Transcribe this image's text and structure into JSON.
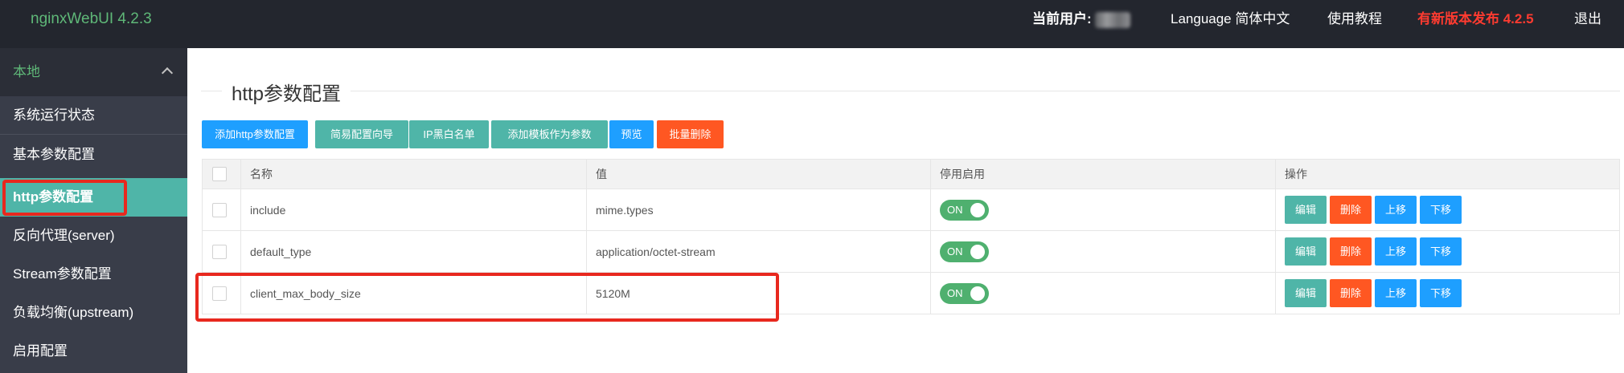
{
  "header": {
    "logo": "nginxWebUI 4.2.3",
    "current_user_label": "当前用户:",
    "language_label": "Language 简体中文",
    "help_label": "使用教程",
    "new_version_label": "有新版本发布 4.2.5",
    "logout_label": "退出"
  },
  "sidebar": {
    "group_label": "本地",
    "items": [
      {
        "label": "系统运行状态"
      },
      {
        "label": "基本参数配置"
      },
      {
        "label": "http参数配置"
      },
      {
        "label": "反向代理(server)"
      },
      {
        "label": "Stream参数配置"
      },
      {
        "label": "负载均衡(upstream)"
      },
      {
        "label": "启用配置"
      }
    ]
  },
  "main": {
    "title": "http参数配置",
    "toolbar": {
      "add_http": "添加http参数配置",
      "wizard": "简易配置向导",
      "ip_blacklist": "IP黑白名单",
      "add_template": "添加模板作为参数",
      "preview": "预览",
      "batch_delete": "批量删除"
    }
  },
  "table": {
    "headers": [
      "名称",
      "值",
      "停用启用",
      "操作"
    ],
    "rows": [
      {
        "name": "include",
        "value": "mime.types",
        "switch": "ON"
      },
      {
        "name": "default_type",
        "value": "application/octet-stream",
        "switch": "ON"
      },
      {
        "name": "client_max_body_size",
        "value": "5120M",
        "switch": "ON"
      }
    ],
    "actions": {
      "edit": "编辑",
      "delete": "删除",
      "up": "上移",
      "down": "下移"
    }
  },
  "colors": {
    "header_bg": "#23262e",
    "sidebar_bg": "#393d49",
    "accent_green": "#5fb878",
    "active_teal": "#4fb5a8",
    "blue": "#1e9fff",
    "orange": "#ff5722",
    "new_version_red": "#ff3b30",
    "highlight_red": "#e8281e"
  }
}
